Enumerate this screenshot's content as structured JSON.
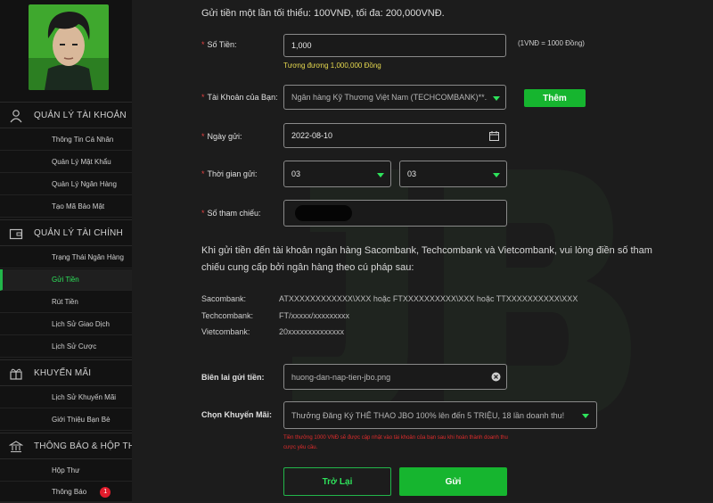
{
  "sidebar": {
    "sections": [
      {
        "title": "QUẢN LÝ TÀI KHOẢN",
        "icon": "user-icon",
        "items": [
          {
            "label": "Thông Tin Cá Nhân"
          },
          {
            "label": "Quản Lý Mật Khẩu"
          },
          {
            "label": "Quản Lý Ngân Hàng"
          },
          {
            "label": "Tạo Mã Bảo Mật"
          }
        ]
      },
      {
        "title": "QUẢN LÝ TÀI CHÍNH",
        "icon": "wallet-icon",
        "items": [
          {
            "label": "Trạng Thái Ngân Hàng"
          },
          {
            "label": "Gửi Tiền",
            "active": true
          },
          {
            "label": "Rút Tiền"
          },
          {
            "label": "Lịch Sử Giao Dịch"
          },
          {
            "label": "Lịch Sử Cược"
          }
        ]
      },
      {
        "title": "KHUYẾN MÃI",
        "icon": "gift-icon",
        "items": [
          {
            "label": "Lịch Sử Khuyến Mãi"
          },
          {
            "label": "Giới Thiệu Bạn Bè"
          }
        ]
      },
      {
        "title": "THÔNG BÁO & HỘP THƯ",
        "icon": "bank-icon",
        "items": [
          {
            "label": "Hộp Thư"
          },
          {
            "label": "Thông Báo",
            "badge": "1"
          }
        ]
      }
    ]
  },
  "form": {
    "top_note": "Gửi tiền một lần tối thiểu: 100VNĐ, tối đa: 200,000VNĐ.",
    "amount_label": "Số Tiền:",
    "amount_value": "1,000",
    "rate_note": "(1VNĐ = 1000 Đồng)",
    "equivalent": "Tương đương 1,000,000 Đồng",
    "account_label": "Tài Khoản của Bạn:",
    "account_value": "Ngân hàng Kỹ Thương Việt Nam (TECHCOMBANK)**...",
    "add_label": "Thêm",
    "date_label": "Ngày gửi:",
    "date_value": "2022-08-10",
    "time_label": "Thời gian gửi:",
    "hour_value": "03",
    "minute_value": "03",
    "ref_label": "Số tham chiếu:",
    "instructions": "Khi gửi tiền đến tài khoản ngân hàng Sacombank, Techcombank và Vietcombank, vui lòng điền số tham chiếu cung cấp bởi ngân hàng theo cú pháp sau:",
    "banks": [
      {
        "name": "Sacombank:",
        "format": "ATXXXXXXXXXXXX\\XXX hoặc FTXXXXXXXXXX\\XXX hoặc TTXXXXXXXXXX\\XXX"
      },
      {
        "name": "Techcombank:",
        "format": "FT/xxxxx/xxxxxxxxx"
      },
      {
        "name": "Vietcombank:",
        "format": "20xxxxxxxxxxxxxx"
      }
    ],
    "receipt_label": "Biên lai gửi tiền:",
    "receipt_value": "huong-dan-nap-tien-jbo.png",
    "promo_label": "Chọn Khuyến Mãi:",
    "promo_value": "Thưởng Đăng Ký THỂ THAO JBO 100% lên đến 5 TRIỆU, 18 lần doanh thu!",
    "promo_warning": "Tiền thưởng 1000 VNĐ sẽ được cập nhật vào tài khoản của bạn sau khi hoàn thành doanh thu cược yêu cầu.",
    "back_label": "Trở Lại",
    "submit_label": "Gửi"
  },
  "colors": {
    "accent": "#16b52f",
    "accent_text": "#2ee35b",
    "required": "#e04141",
    "hint": "#e6d94f",
    "warning": "#e02c2c"
  }
}
